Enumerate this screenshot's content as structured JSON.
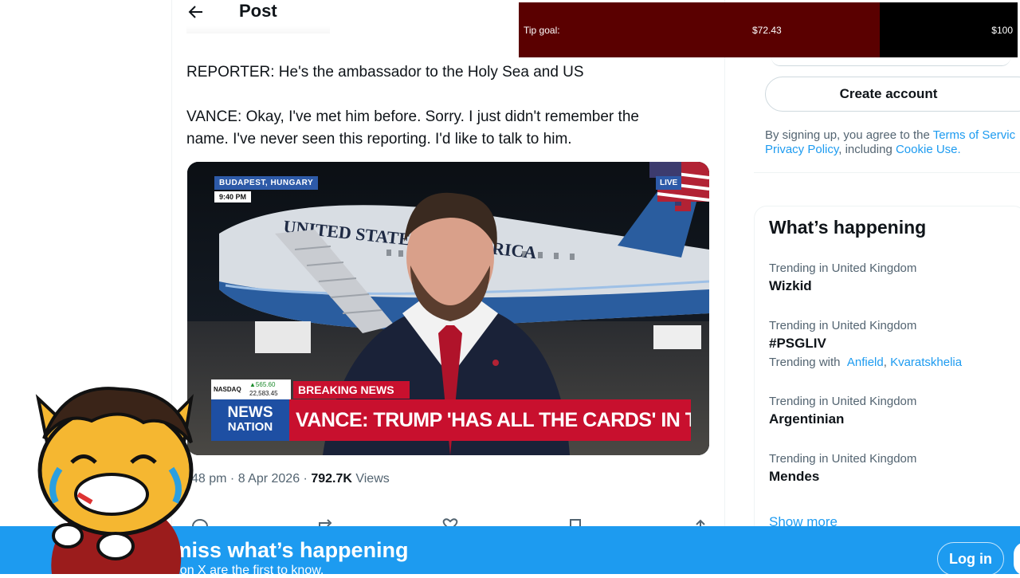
{
  "header": {
    "title": "Post"
  },
  "tweet": {
    "line1": "REPORTER: He's the ambassador to the Holy Sea and US",
    "line2": "VANCE: Okay, I've met him before. Sorry. I just didn't remember the",
    "line3": "name. I've never seen this reporting. I'd like to talk to him.",
    "meta_time": "48 pm · 8 Apr 2026 ·",
    "views_count": "792.7K",
    "views_label": "Views"
  },
  "media": {
    "location": "BUDAPEST, HUNGARY",
    "time": "9:40 PM",
    "live": "LIVE",
    "nasdaq_label": "NASDAQ",
    "nasdaq_change": "▲565.60",
    "nasdaq_value": "22,583.45",
    "channel_line1": "NEWS",
    "channel_line2": "NATION",
    "breaking": "BREAKING NEWS",
    "headline": "VANCE: TRUMP 'HAS ALL THE CARDS' IN TALKS",
    "plane_text": "UNITED STATES OF AMERICA"
  },
  "tip_goal": {
    "label": "Tip goal:",
    "current": "$72.43",
    "goal": "$100",
    "progress": 0.7243
  },
  "sidebar": {
    "create_account": "Create account",
    "terms_prefix": "By signing up, you agree to the",
    "terms_link": "Terms of Servic",
    "privacy_link": "Privacy Policy",
    "terms_mid": ", including",
    "cookie_link": "Cookie Use."
  },
  "whats_happening": {
    "title": "What’s happening",
    "trends": [
      {
        "context": "Trending in United Kingdom",
        "name": "Wizkid"
      },
      {
        "context": "Trending in United Kingdom",
        "name": "#PSGLIV",
        "with_label": "Trending with",
        "with_1": "Anfield",
        "with_2": "Kvaratskhelia"
      },
      {
        "context": "Trending in United Kingdom",
        "name": "Argentinian"
      },
      {
        "context": "Trending in United Kingdom",
        "name": "Mendes"
      }
    ],
    "show_more": "Show more"
  },
  "banner": {
    "title": "t miss what’s happening",
    "subtitle": "ple on X are the first to know.",
    "login": "Log in"
  },
  "colors": {
    "accent": "#1d9bf0",
    "tip_fill": "#5a0000",
    "breaking_red": "#c8102e"
  }
}
